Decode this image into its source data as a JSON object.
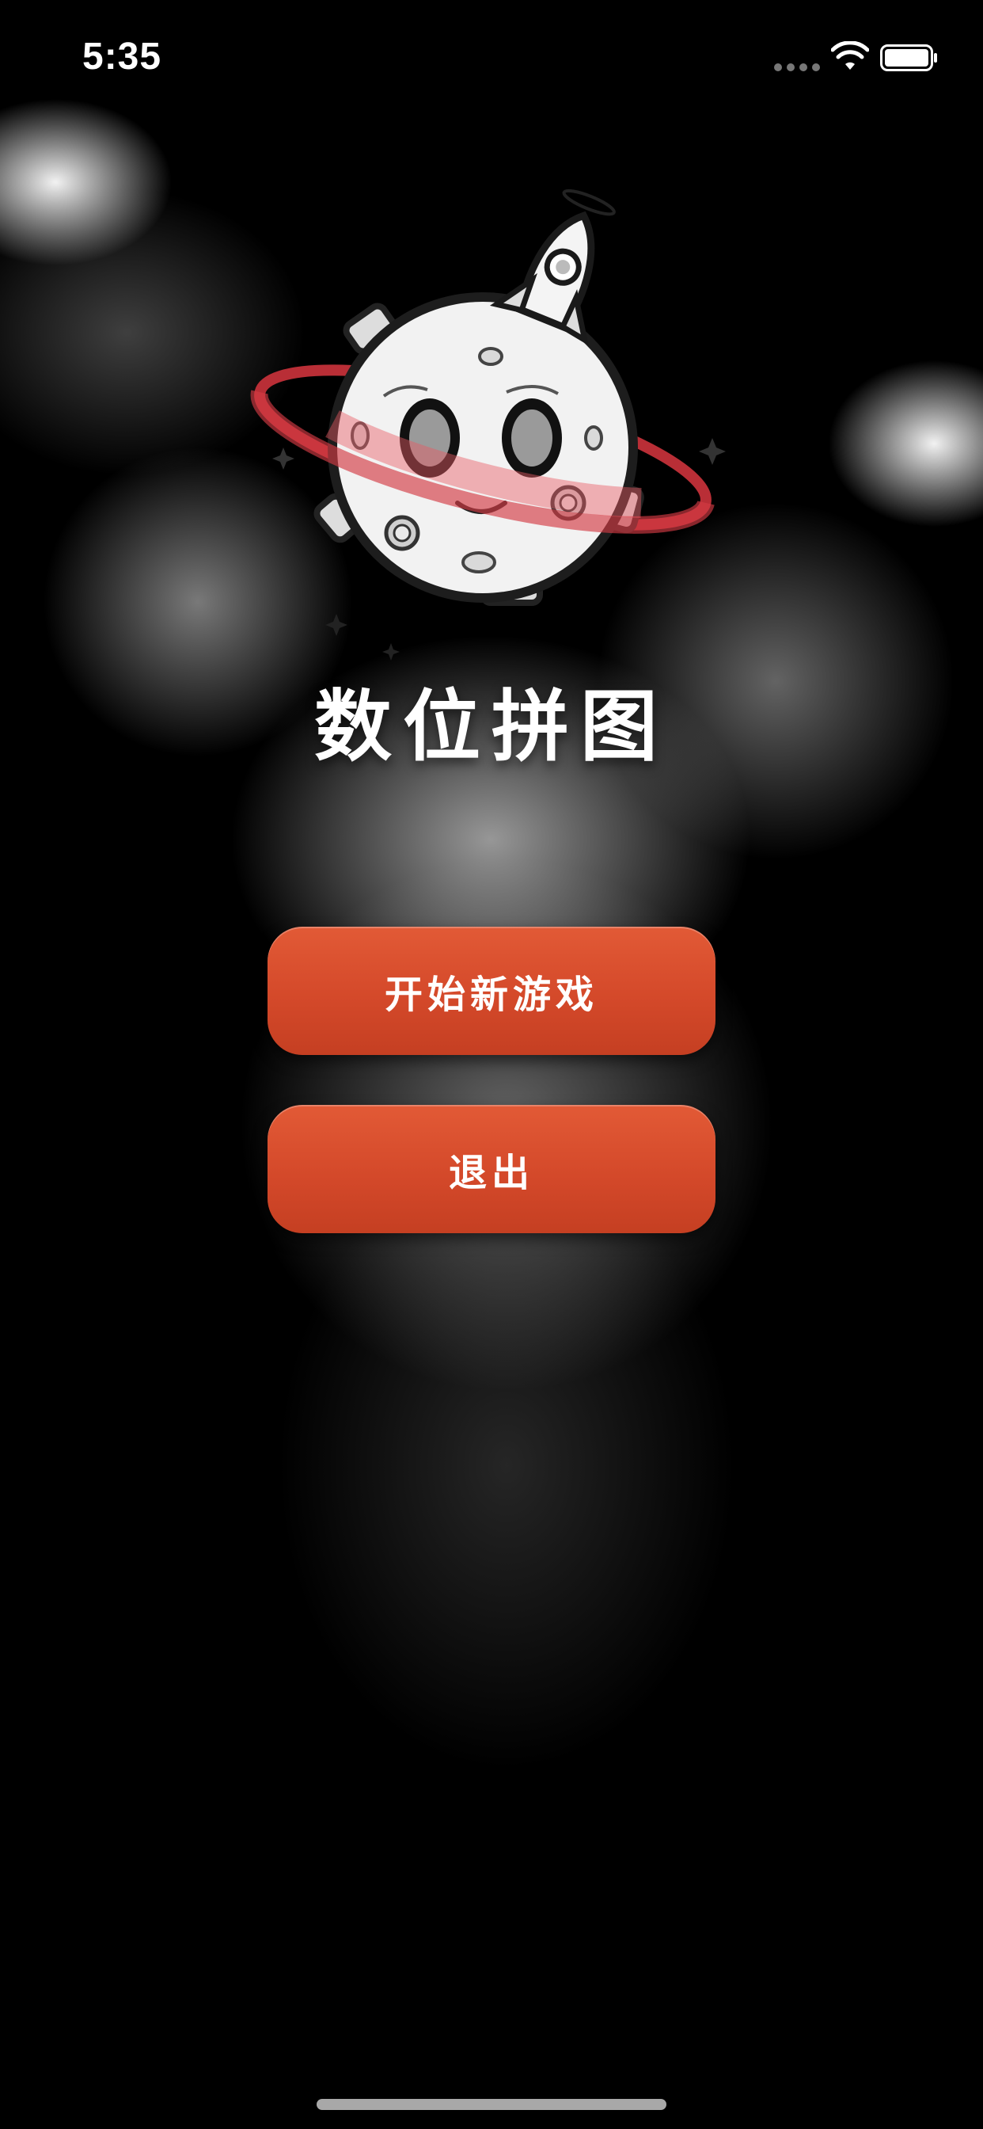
{
  "status_bar": {
    "time": "5:35",
    "icons": [
      "cellular-signal-icon",
      "wifi-icon",
      "battery-icon"
    ]
  },
  "game": {
    "title": "数位拼图",
    "mascot": "moon-planet-with-rocket-logo"
  },
  "menu": {
    "start_label": "开始新游戏",
    "exit_label": "退出"
  },
  "colors": {
    "button": "#d84c2c",
    "background": "#000000",
    "ring": "#c0303a",
    "text": "#ffffff"
  }
}
